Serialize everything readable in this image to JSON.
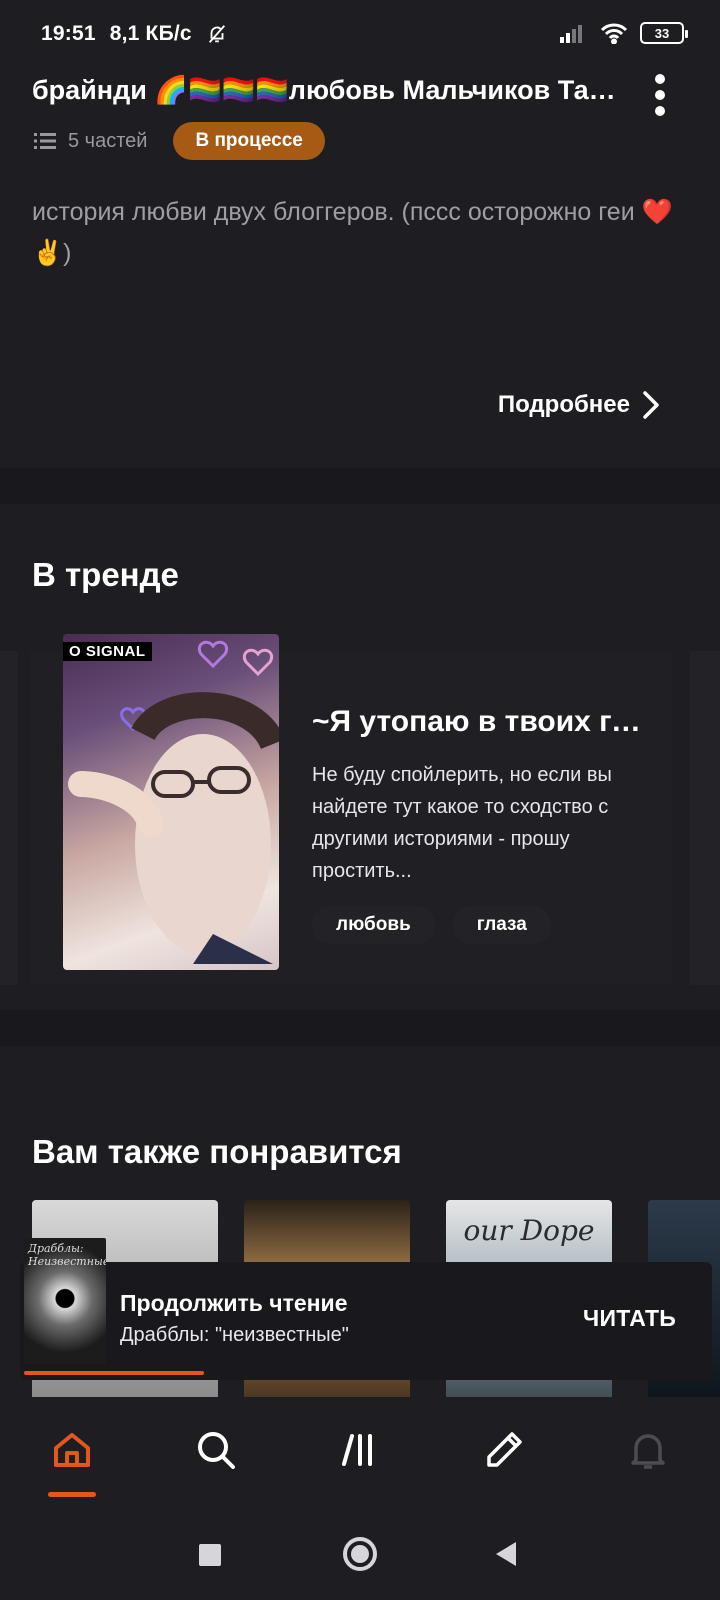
{
  "status_bar": {
    "time": "19:51",
    "speed": "8,1 КБ/с",
    "battery": "33"
  },
  "story": {
    "title": "брайнди 🌈🏳️‍🌈🏳️‍🌈🏳️‍🌈любовь Мальчиков Тайми",
    "parts": "5 частей",
    "status_badge": "В процессе",
    "description": "история любви двух блоггеров. (пссс осторожно геи ❤️✌️)",
    "more_label": "Подробнее"
  },
  "trending": {
    "heading": "В тренде",
    "cover_overlay": "O SIGNAL",
    "title": "~Я утопаю в твоих глазах~",
    "description": "Не буду спойлерить, но если вы найдете тут какое то сходство с другими историями - прошу простить...",
    "tags": [
      "любовь",
      "глаза"
    ]
  },
  "recommended": {
    "heading": "Вам также понравится",
    "cover3_text": "our Dope"
  },
  "continue_reading": {
    "title": "Продолжить чтение",
    "subtitle": "Драбблы: \"неизвестные\"",
    "action": "ЧИТАТЬ",
    "cover_text": "Драбблы: Неизвестные",
    "progress": 0.27
  },
  "tabs": [
    {
      "name": "home",
      "icon": "home-icon",
      "active": true
    },
    {
      "name": "search",
      "icon": "search-icon"
    },
    {
      "name": "library",
      "icon": "library-icon"
    },
    {
      "name": "write",
      "icon": "pencil-icon"
    },
    {
      "name": "notifications",
      "icon": "bell-icon"
    }
  ],
  "colors": {
    "accent": "#e2581c",
    "badge": "#a65a14",
    "background": "#1e1d21"
  }
}
